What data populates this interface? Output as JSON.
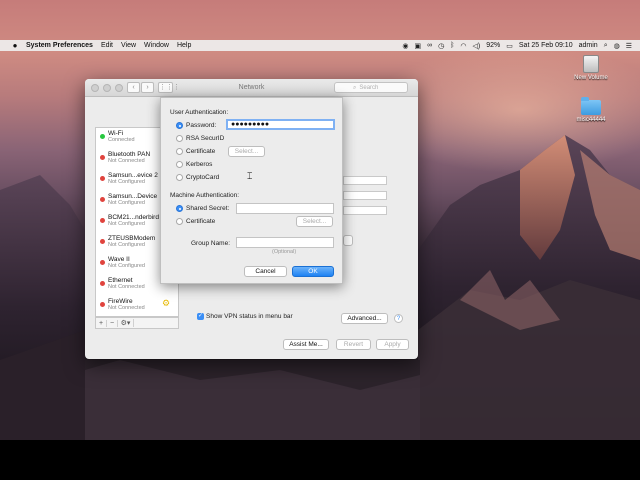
{
  "menubar": {
    "app": "System Preferences",
    "items": [
      "Edit",
      "View",
      "Window",
      "Help"
    ],
    "battery": "92%",
    "datetime": "Sat 25 Feb  09:10",
    "user": "admin"
  },
  "desktop": {
    "icons": [
      "New Volume",
      "misc44444"
    ]
  },
  "network_window": {
    "title": "Network",
    "search_placeholder": "Search",
    "services": [
      {
        "name": "Wi-Fi",
        "status": "Connected",
        "color": "#28c840"
      },
      {
        "name": "Bluetooth PAN",
        "status": "Not Connected",
        "color": "#e0443e"
      },
      {
        "name": "Samsun...evice 2",
        "status": "Not Configured",
        "color": "#e0443e"
      },
      {
        "name": "Samsun...Device",
        "status": "Not Configured",
        "color": "#e0443e"
      },
      {
        "name": "BCM21...nderbird",
        "status": "Not Configured",
        "color": "#e0443e"
      },
      {
        "name": "ZTEUSBModem",
        "status": "Not Configured",
        "color": "#e0443e"
      },
      {
        "name": "Wave II",
        "status": "Not Configured",
        "color": "#e0443e"
      },
      {
        "name": "Ethernet",
        "status": "Not Connected",
        "color": "#e0443e"
      },
      {
        "name": "FireWire",
        "status": "Not Connected",
        "color": "#e0443e"
      }
    ],
    "footer_buttons": [
      "+",
      "−",
      "⚙▾"
    ],
    "show_vpn_label": "Show VPN status in menu bar",
    "advanced_label": "Advanced...",
    "assist_label": "Assist Me...",
    "revert_label": "Revert",
    "apply_label": "Apply"
  },
  "auth_sheet": {
    "user_auth_heading": "User Authentication:",
    "options_user": [
      "Password:",
      "RSA SecurID",
      "Certificate",
      "Kerberos",
      "CryptoCard"
    ],
    "password_value": "●●●●●●●●●",
    "select_label": "Select...",
    "machine_auth_heading": "Machine Authentication:",
    "options_machine": [
      "Shared Secret:",
      "Certificate"
    ],
    "shared_secret_value": "",
    "group_name_label": "Group Name:",
    "group_name_value": "",
    "optional_hint": "(Optional)",
    "cancel_label": "Cancel",
    "ok_label": "OK"
  },
  "colors": {
    "accent": "#3b8ff6",
    "connected": "#28c840",
    "disconnected": "#e0443e"
  }
}
